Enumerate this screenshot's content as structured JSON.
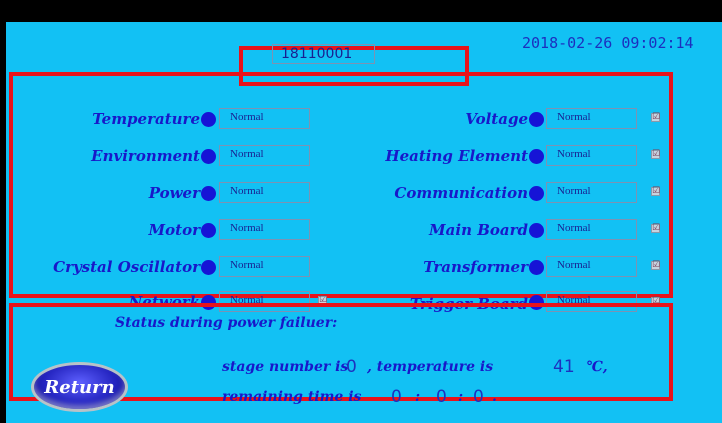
{
  "header": {
    "datetime": "2018-02-26 09:02:14"
  },
  "device_id": "18110001",
  "left_items": [
    {
      "label": "Temperature",
      "value": "Normal"
    },
    {
      "label": "Environment",
      "value": "Normal"
    },
    {
      "label": "Power",
      "value": "Normal"
    },
    {
      "label": "Motor",
      "value": "Normal"
    },
    {
      "label": "Crystal Oscillator",
      "value": "Normal"
    },
    {
      "label": "Network",
      "value": "Normal",
      "checkbox": "☑"
    }
  ],
  "right_items": [
    {
      "label": "Voltage",
      "value": "Normal",
      "checkbox": "☑"
    },
    {
      "label": "Heating Element",
      "value": "Normal",
      "checkbox": "☑"
    },
    {
      "label": "Communication",
      "value": "Normal",
      "checkbox": "☑"
    },
    {
      "label": "Main Board",
      "value": "Normal",
      "checkbox": "☑"
    },
    {
      "label": "Transformer",
      "value": "Normal",
      "checkbox": "☑"
    },
    {
      "label": "Trigger Board",
      "value": "Normal",
      "checkbox": "☑"
    }
  ],
  "power_failure": {
    "title": "Status during power failuer:",
    "stage_text": "stage number is",
    "stage_value": "0",
    "temp_text": ", temperature is",
    "temp_value": "41",
    "temp_unit": "℃,",
    "remaining_text": "remaining time is",
    "hours": "0",
    "sep1": ":",
    "minutes": "0",
    "sep2": ":",
    "seconds": "0",
    "end": "."
  },
  "return_label": "Return",
  "colors": {
    "background": "#12c1f4",
    "frame": "#e8131b",
    "text": "#1818c9"
  }
}
